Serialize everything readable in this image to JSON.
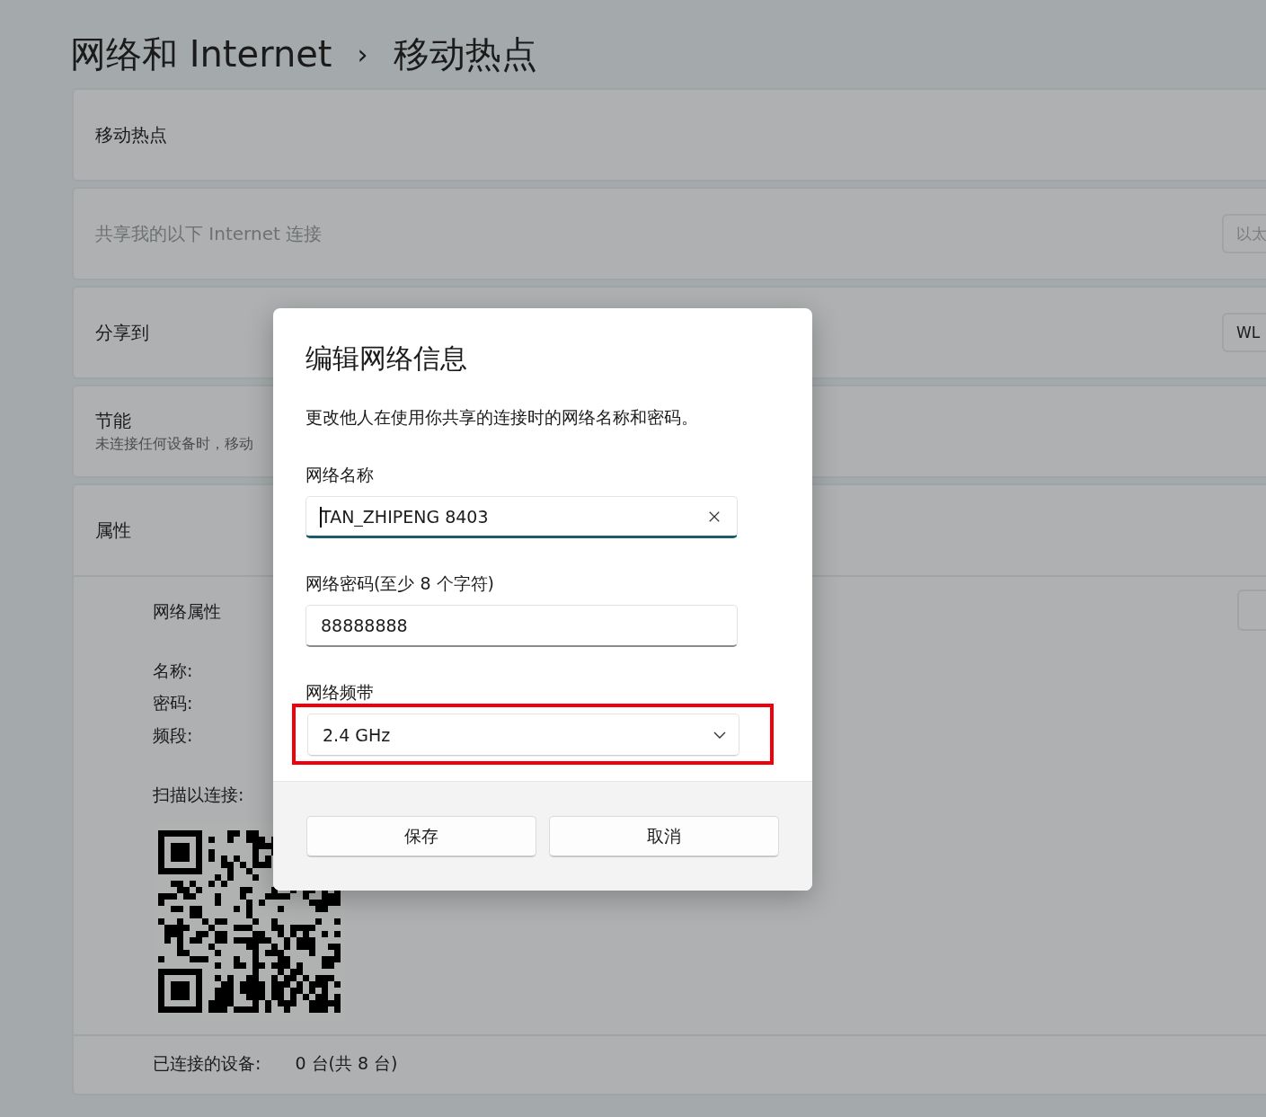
{
  "breadcrumb": {
    "parent": "网络和 Internet",
    "separator": "›",
    "current": "移动热点"
  },
  "cards": [
    {
      "kind": "toggle",
      "title": "移动热点"
    },
    {
      "kind": "dropdown",
      "title": "共享我的以下 Internet 连接",
      "disabled": true,
      "control": "以太"
    },
    {
      "kind": "dropdown",
      "title": "分享到",
      "disabled": false,
      "control": "WL"
    },
    {
      "kind": "toggle",
      "title": "节能",
      "subtitle": "未连接任何设备时，移动"
    },
    {
      "kind": "properties",
      "title": "属性",
      "section": "网络属性",
      "fields": [
        "名称:",
        "密码:",
        "频段:"
      ],
      "scan_label": "扫描以连接:",
      "devices_label": "已连接的设备:",
      "devices_value": "0 台(共 8 台)"
    }
  ],
  "dialog": {
    "title": "编辑网络信息",
    "description": "更改他人在使用你共享的连接时的网络名称和密码。",
    "fields": [
      {
        "kind": "text",
        "label": "网络名称",
        "value": "TAN_ZHIPENG 8403",
        "focused": true,
        "highlighted": false
      },
      {
        "kind": "text",
        "label": "网络密码(至少 8 个字符)",
        "value": "88888888",
        "focused": false,
        "highlighted": false
      },
      {
        "kind": "select",
        "label": "网络频带",
        "value": "2.4 GHz",
        "focused": false,
        "highlighted": true
      }
    ],
    "buttons": [
      "保存",
      "取消"
    ]
  }
}
